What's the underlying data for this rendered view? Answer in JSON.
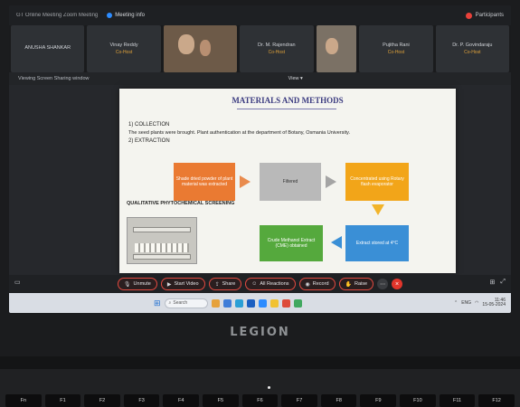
{
  "title_bar": {
    "app_title": "GT Online Meeting Zoom Meeting",
    "host_name": "Meeting info",
    "participants_label": "Participants"
  },
  "participants": [
    {
      "name": "ANUSHA SHANKAR",
      "sub": ""
    },
    {
      "name": "Vinay Reddy",
      "sub": "Co-Host"
    },
    {
      "name": "",
      "sub": "",
      "video": true
    },
    {
      "name": "Dr. M. Rajendran",
      "sub": "Co-Host"
    },
    {
      "name": "",
      "sub": "",
      "video": true
    },
    {
      "name": "Pujitha Rani",
      "sub": "Co-Host"
    },
    {
      "name": "Dr. P. Govindaraju",
      "sub": "Co-Host"
    }
  ],
  "share_bar": {
    "left_text": "Viewing Screen Sharing window",
    "view_label": "View"
  },
  "slide": {
    "title": "MATERIALS AND METHODS",
    "line1": "1) COLLECTION",
    "line2": "The seed plants were brought. Plant authentication at the department of Botany, Osmania University.",
    "line3": "2) EXTRACTION",
    "side_label": "QUALITATIVE PHYTOCHEMICAL SCREENING",
    "flowchart": [
      "Shade dried powder of plant material was extracted",
      "Filtered",
      "Concentrated using Rotary flash evaporator",
      "Extract stored at 4°C",
      "Crude Methanol Extract (CME) obtained"
    ]
  },
  "toolbar": {
    "unmute": "Unmute",
    "start_video": "Start Video",
    "share": "Share",
    "all_reactions": "All Reactions",
    "record": "Record",
    "raise": "Raise",
    "end_icon": "×",
    "more_icon": "⋯"
  },
  "taskbar": {
    "search": "Search",
    "language": "ENG",
    "time": "11:46",
    "date": "15-05-2024"
  },
  "laptop": {
    "brand": "LEGION",
    "fkeys": [
      "Fn",
      "F1",
      "F2",
      "F3",
      "F4",
      "F5",
      "F6",
      "F7",
      "F8",
      "F9",
      "F10",
      "F11",
      "F12"
    ]
  },
  "colors": {
    "accent_red": "#e34a40",
    "zoom_blue": "#2d8cff",
    "flow_orange": "#ea7a32",
    "flow_gray": "#b9b9b9",
    "flow_amber": "#f2a519",
    "flow_blue": "#3a8fd6",
    "flow_green": "#55a93d"
  }
}
